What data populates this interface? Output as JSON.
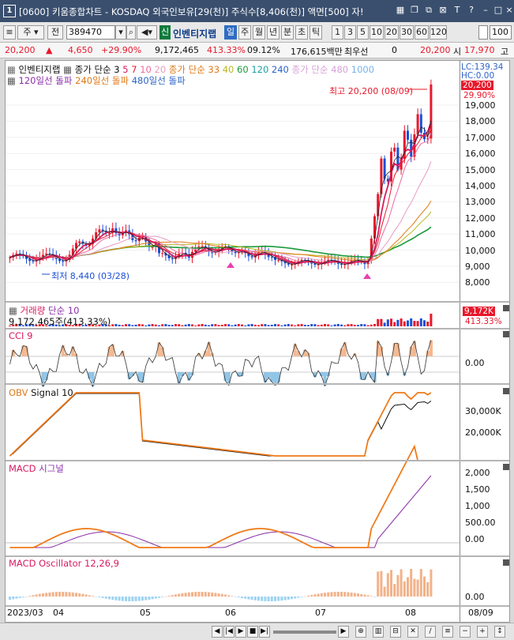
{
  "titlebar": {
    "index": "1",
    "title": "[0600] 키움종합차트 - KOSDAQ 외국인보유[29(천)] 주식수[8,406(천)] 액면[500] 자!"
  },
  "toolbar": {
    "period_sel": "주",
    "jeon": "전",
    "code": "389470",
    "inventory_label": "인벤티지랩",
    "badge_sin": "신",
    "periods": [
      "일",
      "주",
      "월",
      "년",
      "분",
      "초",
      "틱"
    ],
    "intervals": [
      "1",
      "3",
      "5",
      "10",
      "20",
      "30",
      "60",
      "120"
    ],
    "count": "100"
  },
  "quote": {
    "price": "20,200",
    "change": "4,650",
    "change_pct": "+29.90%",
    "volume": "9,172,465",
    "vol_ratio": "413.33%",
    "turnover": "09.12%",
    "amount": "176,615백만",
    "best_bid_label": "최우선",
    "best_bid": "0",
    "price2": "20,200",
    "low_label": "시",
    "low": "17,970",
    "high_label": "고"
  },
  "price_panel": {
    "name": "인벤티지랩",
    "legend1": "종가 단순 3",
    "legend1_nums": [
      "5",
      "7",
      "10",
      "20"
    ],
    "legend2": "종가 단순 33",
    "legend2_nums": [
      "40",
      "60",
      "120",
      "240"
    ],
    "legend3": "종가 단순 480",
    "legend3_num": "1000",
    "legend_row2": [
      "120일선 돌파",
      "240일선 돌파",
      "480일선 돌파"
    ],
    "lc": "LC:139.34",
    "hc": "HC:0.00",
    "current_price": "20,200",
    "current_pct": "29.90%",
    "max_label": "최고 20,200 (08/09)",
    "min_label": "최저 8,440 (03/28)",
    "y_ticks": [
      "19,000",
      "18,000",
      "17,000",
      "16,000",
      "15,000",
      "14,000",
      "13,000",
      "12,000",
      "11,000",
      "10,000",
      "9,000",
      "8,000"
    ]
  },
  "volume_panel": {
    "label": "거래량",
    "sub": "단순 10",
    "value": "9,172,465주(413.33%)",
    "tag": "9,172K",
    "tag_pct": "413.33%"
  },
  "cci_panel": {
    "label": "CCI 9",
    "y_tick": "0.00"
  },
  "obv_panel": {
    "label": "OBV",
    "signal": "Signal 10",
    "y_ticks": [
      "30,000K",
      "20,000K"
    ]
  },
  "macd_panel": {
    "label": "MACD",
    "signal": "시그널",
    "y_ticks": [
      "2,000",
      "1,500",
      "1,000",
      "500.00",
      "0.00"
    ]
  },
  "osc_panel": {
    "label": "MACD Oscillator 12,26,9",
    "y_tick": "0.00"
  },
  "x_axis": {
    "labels": [
      "2023/03",
      "04",
      "05",
      "06",
      "07",
      "08"
    ],
    "right_label": "08/09"
  },
  "colors": {
    "up": "#e8182b",
    "down": "#1c4fd6",
    "title_bg": "#3a4f6e",
    "obv": "#f07a18",
    "macd": "#f07a18",
    "signal": "#8b2fa8",
    "osc": "#f2b28a",
    "cci_fill_pos": "#f3b890",
    "cci_fill_neg": "#8fc4e6"
  }
}
